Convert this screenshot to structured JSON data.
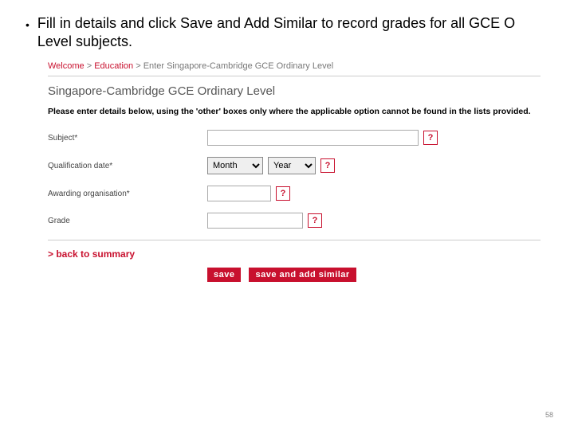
{
  "bullet": {
    "text": "Fill in details and click Save and Add Similar to record grades for all GCE O Level subjects."
  },
  "breadcrumb": {
    "welcome": "Welcome",
    "sep": ">",
    "education": "Education",
    "current": "Enter Singapore-Cambridge GCE Ordinary Level"
  },
  "section_title": "Singapore-Cambridge GCE Ordinary Level",
  "instruction": "Please enter details below, using the 'other' boxes only where the applicable option cannot be found in the lists provided.",
  "fields": {
    "subject": {
      "label": "Subject*",
      "value": ""
    },
    "qual_date": {
      "label": "Qualification date*",
      "month": "Month",
      "year": "Year"
    },
    "awarding": {
      "label": "Awarding organisation*",
      "value": ""
    },
    "grade": {
      "label": "Grade",
      "value": ""
    }
  },
  "help_glyph": "?",
  "back_link": "> back to summary",
  "buttons": {
    "save": "save",
    "save_add": "save and add similar"
  },
  "page_number": "58"
}
